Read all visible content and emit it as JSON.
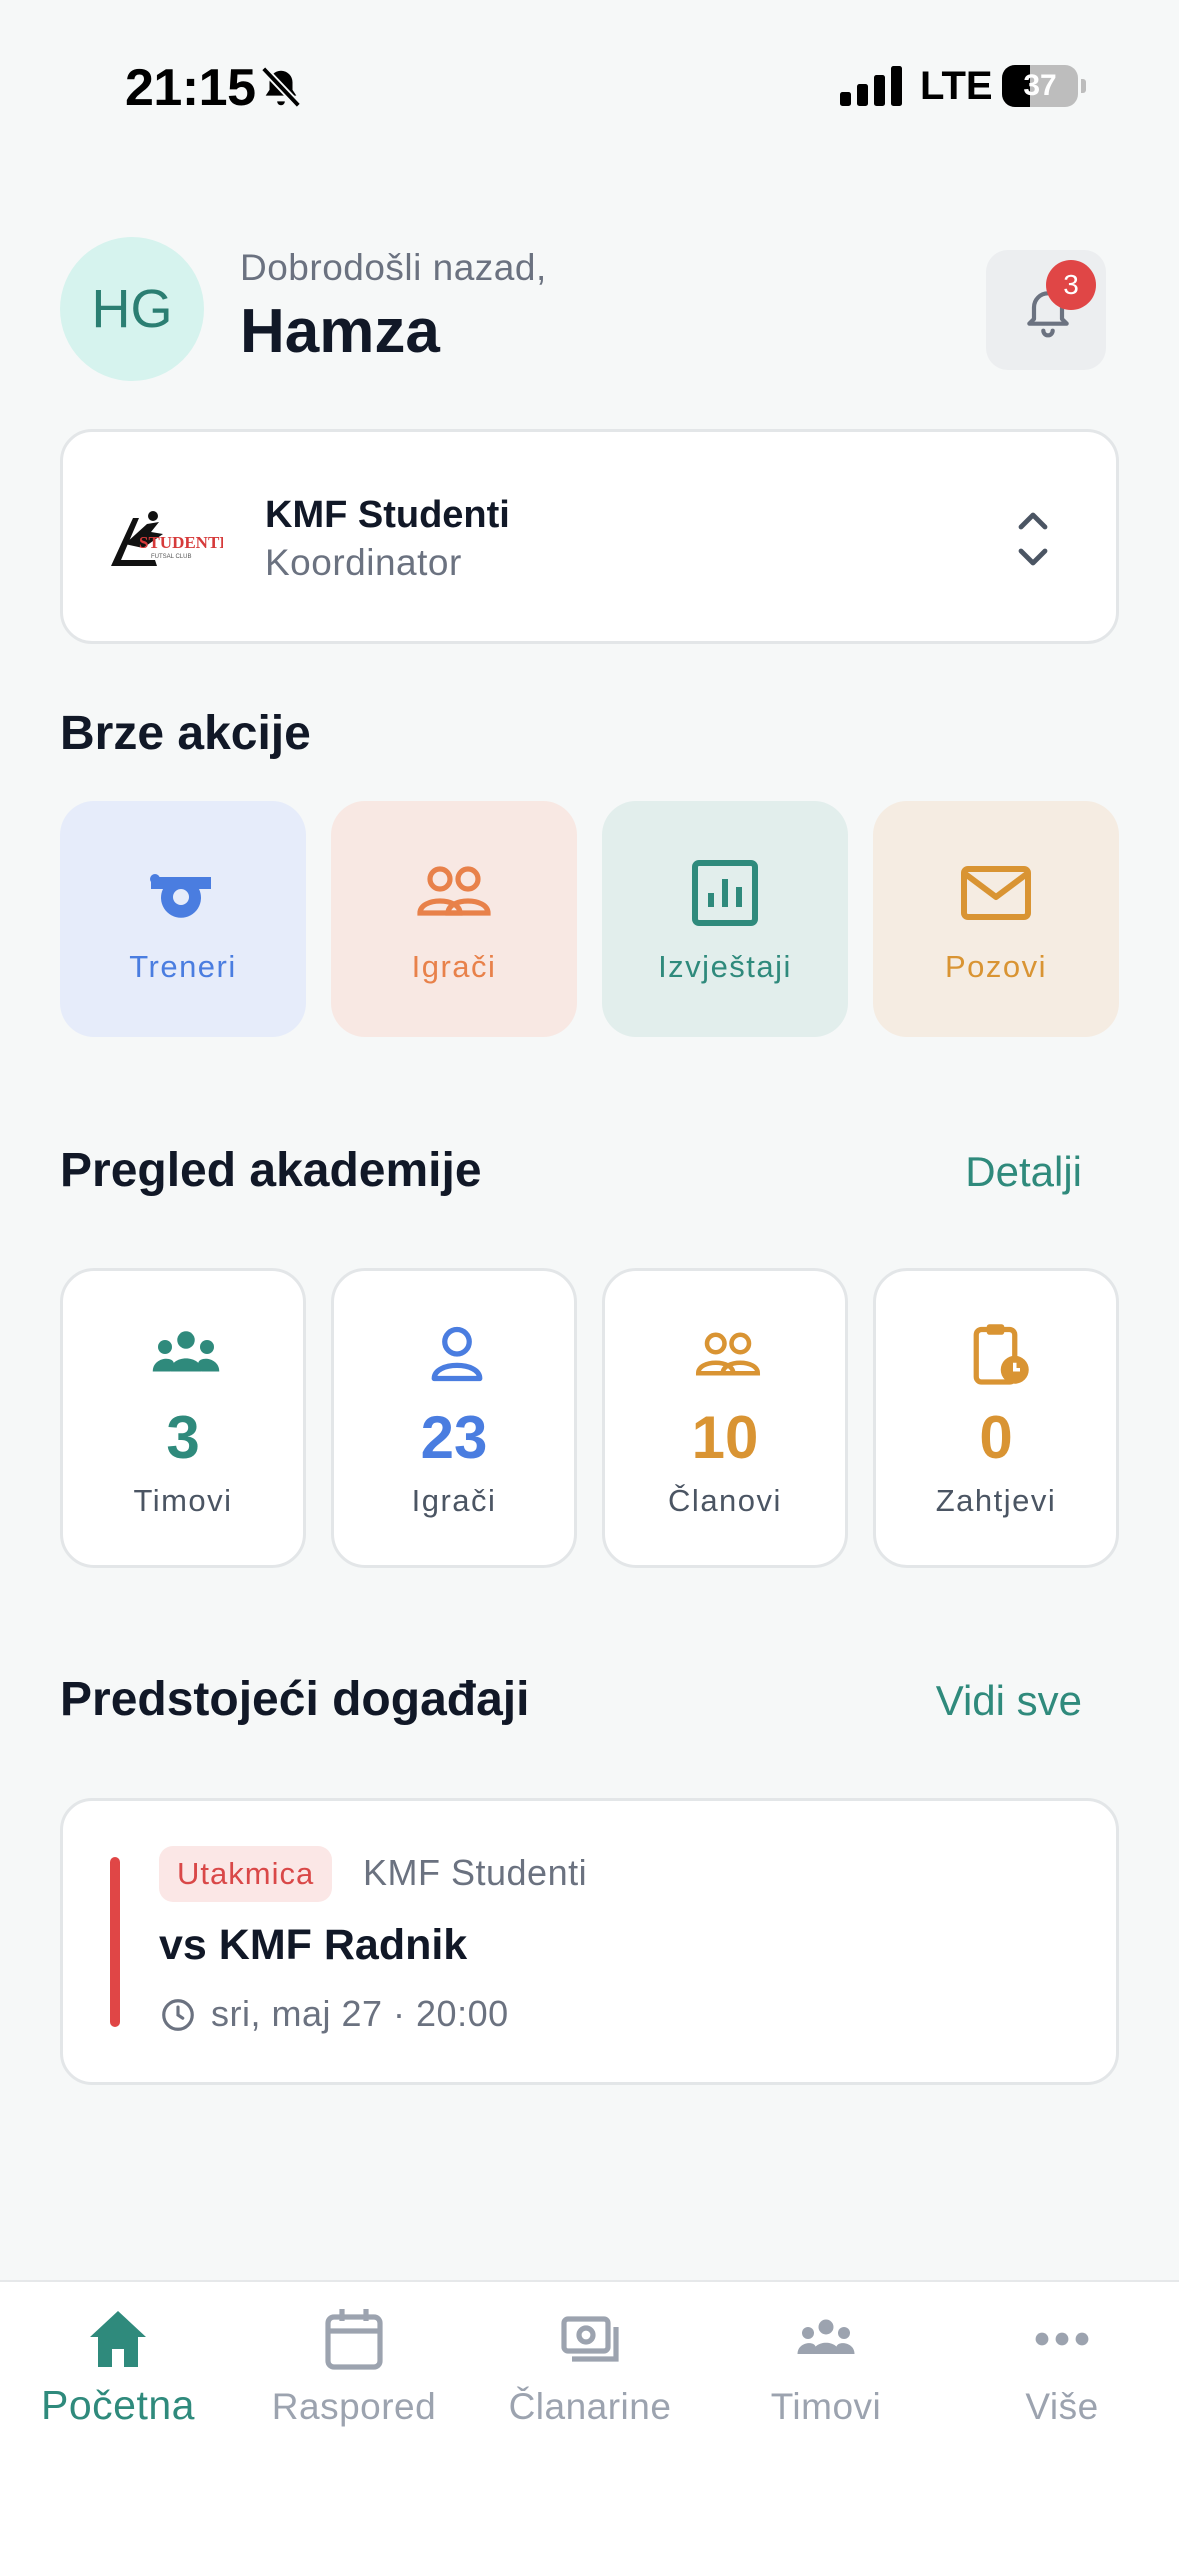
{
  "status_bar": {
    "time": "21:15",
    "network": "LTE",
    "battery": 37,
    "battery_label": "37",
    "icons": [
      "bell-off-icon",
      "signal-icon",
      "battery-icon"
    ]
  },
  "header": {
    "avatar_initials": "HG",
    "welcome": "Dobrodošli nazad,",
    "name": "Hamza",
    "notification_count": "3"
  },
  "club": {
    "name": "KMF Studenti",
    "role": "Koordinator"
  },
  "quick_actions": {
    "title": "Brze akcije",
    "items": [
      {
        "label": "Treneri",
        "icon": "whistle-icon",
        "color": "#4a7de0",
        "bg": "#e6ecfa"
      },
      {
        "label": "Igrači",
        "icon": "users-icon",
        "color": "#e8814a",
        "bg": "#f8e8e3"
      },
      {
        "label": "Izvještaji",
        "icon": "chart-icon",
        "color": "#2f8a7c",
        "bg": "#e2eeec"
      },
      {
        "label": "Pozovi",
        "icon": "mail-icon",
        "color": "#d99433",
        "bg": "#f5ece2"
      }
    ]
  },
  "overview": {
    "title": "Pregled akademije",
    "link": "Detalji",
    "stats": [
      {
        "value": "3",
        "label": "Timovi",
        "icon": "team-icon",
        "color": "#2f8a7c"
      },
      {
        "value": "23",
        "label": "Igrači",
        "icon": "user-icon",
        "color": "#4a7de0"
      },
      {
        "value": "10",
        "label": "Članovi",
        "icon": "members-icon",
        "color": "#d99433"
      },
      {
        "value": "0",
        "label": "Zahtjevi",
        "icon": "clipboard-clock-icon",
        "color": "#d99433"
      }
    ]
  },
  "events": {
    "title": "Predstojeći događaji",
    "link": "Vidi sve",
    "items": [
      {
        "tag": "Utakmica",
        "team": "KMF Studenti",
        "title": "vs KMF Radnik",
        "time": "sri, maj 27 · 20:00"
      }
    ]
  },
  "bottom_nav": {
    "items": [
      {
        "label": "Početna",
        "icon": "home-icon",
        "active": true
      },
      {
        "label": "Raspored",
        "icon": "calendar-icon",
        "active": false
      },
      {
        "label": "Članarine",
        "icon": "money-icon",
        "active": false
      },
      {
        "label": "Timovi",
        "icon": "team-icon",
        "active": false
      },
      {
        "label": "Više",
        "icon": "more-icon",
        "active": false
      }
    ]
  },
  "colors": {
    "accent": "#2f8a7c",
    "badge": "#e04646",
    "background": "#f6f8f8"
  }
}
